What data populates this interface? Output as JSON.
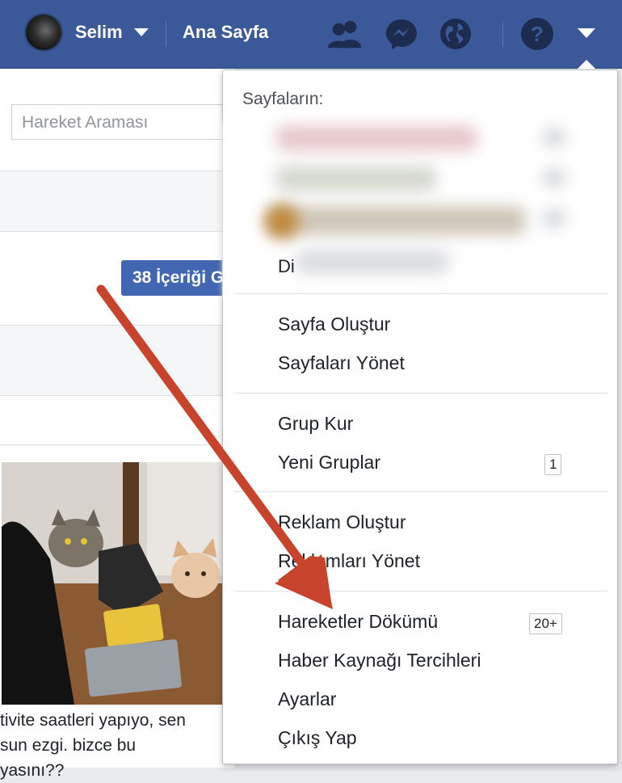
{
  "topbar": {
    "user_name": "Selim",
    "home_label": "Ana Sayfa",
    "icons": [
      "friends-icon",
      "messenger-icon",
      "globe-icon",
      "help-icon",
      "account-menu-caret-icon"
    ]
  },
  "left": {
    "search_placeholder": "Hareket Araması",
    "content_button": "38 İçeriği G",
    "post_text_lines": [
      "tivite saatleri yapıyo, sen",
      "sun ezgi. bizce bu",
      "yasını??"
    ]
  },
  "menu": {
    "pages_header": "Sayfaların:",
    "partial_item": "Di",
    "groups": [
      {
        "items": [
          {
            "label": "Sayfa Oluştur"
          },
          {
            "label": "Sayfaları Yönet"
          }
        ]
      },
      {
        "items": [
          {
            "label": "Grup Kur"
          },
          {
            "label": "Yeni Gruplar",
            "badge": "1"
          }
        ]
      },
      {
        "items": [
          {
            "label": "Reklam Oluştur"
          },
          {
            "label": "Reklamları Yönet"
          }
        ]
      },
      {
        "items": [
          {
            "label": "Hareketler Dökümü",
            "badge": "20+"
          },
          {
            "label": "Haber Kaynağı Tercihleri"
          },
          {
            "label": "Ayarlar"
          },
          {
            "label": "Çıkış Yap"
          }
        ]
      }
    ]
  },
  "colors": {
    "brand": "#3b5998",
    "button": "#4267b2",
    "annotation_arrow": "#c8432b"
  }
}
